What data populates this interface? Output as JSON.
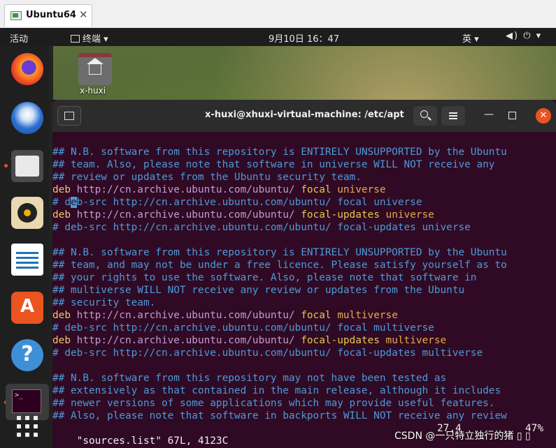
{
  "vm_tab": {
    "title": "Ubuntu64",
    "close": "✕"
  },
  "topbar": {
    "activities": "活动",
    "app_menu": "终端 ▾",
    "clock": "9月10日  16：47",
    "ime": "英 ▾",
    "system": "◀) ⏻ ▾"
  },
  "desktop": {
    "home_label": "x-huxi"
  },
  "dock": {
    "items": [
      "firefox-icon",
      "thunderbird-icon",
      "files-icon",
      "rhythmbox-icon",
      "writer-icon",
      "software-icon",
      "help-icon",
      "terminal-icon",
      "show-apps-icon"
    ],
    "software_glyph": "A",
    "help_glyph": "?",
    "terminal_prompt": ">_"
  },
  "terminal": {
    "title": "x-huxi@xhuxi-virtual-machine: /etc/apt",
    "minimize": "—",
    "close": "✕",
    "lines": [
      [
        {
          "t": "## N.B. software from this repository is ENTIRELY UNSUPPORTED by the Ubuntu",
          "c": "c"
        }
      ],
      [
        {
          "t": "## team. Also, please note that software in universe WILL NOT receive any",
          "c": "c"
        }
      ],
      [
        {
          "t": "## review or updates from the Ubuntu security team.",
          "c": "c"
        }
      ],
      [
        {
          "t": "deb",
          "c": "k"
        },
        {
          "t": " http://cn.archive.ubuntu.com/ubuntu/ ",
          "c": "u"
        },
        {
          "t": "focal",
          "c": "s"
        },
        {
          "t": " universe",
          "c": "p"
        }
      ],
      [
        {
          "t": "# d",
          "c": "c"
        },
        {
          "t": "e",
          "c": "cursor"
        },
        {
          "t": "b-src http://cn.archive.ubuntu.com/ubuntu/ focal universe",
          "c": "c"
        }
      ],
      [
        {
          "t": "deb",
          "c": "k"
        },
        {
          "t": " http://cn.archive.ubuntu.com/ubuntu/ ",
          "c": "u"
        },
        {
          "t": "focal-updates",
          "c": "s"
        },
        {
          "t": " universe",
          "c": "p"
        }
      ],
      [
        {
          "t": "# deb-src http://cn.archive.ubuntu.com/ubuntu/ focal-updates universe",
          "c": "c"
        }
      ],
      [
        {
          "t": "",
          "c": "c"
        }
      ],
      [
        {
          "t": "## N.B. software from this repository is ENTIRELY UNSUPPORTED by the Ubuntu",
          "c": "c"
        }
      ],
      [
        {
          "t": "## team, and may not be under a free licence. Please satisfy yourself as to",
          "c": "c"
        }
      ],
      [
        {
          "t": "## your rights to use the software. Also, please note that software in",
          "c": "c"
        }
      ],
      [
        {
          "t": "## multiverse WILL NOT receive any review or updates from the Ubuntu",
          "c": "c"
        }
      ],
      [
        {
          "t": "## security team.",
          "c": "c"
        }
      ],
      [
        {
          "t": "deb",
          "c": "k"
        },
        {
          "t": " http://cn.archive.ubuntu.com/ubuntu/ ",
          "c": "u"
        },
        {
          "t": "focal",
          "c": "s"
        },
        {
          "t": " multiverse",
          "c": "p"
        }
      ],
      [
        {
          "t": "# deb-src http://cn.archive.ubuntu.com/ubuntu/ focal multiverse",
          "c": "c"
        }
      ],
      [
        {
          "t": "deb",
          "c": "k"
        },
        {
          "t": " http://cn.archive.ubuntu.com/ubuntu/ ",
          "c": "u"
        },
        {
          "t": "focal-updates",
          "c": "s"
        },
        {
          "t": " multiverse",
          "c": "p"
        }
      ],
      [
        {
          "t": "# deb-src http://cn.archive.ubuntu.com/ubuntu/ focal-updates multiverse",
          "c": "c"
        }
      ],
      [
        {
          "t": "",
          "c": "c"
        }
      ],
      [
        {
          "t": "## N.B. software from this repository may not have been tested as",
          "c": "c"
        }
      ],
      [
        {
          "t": "## extensively as that contained in the main release, although it includes",
          "c": "c"
        }
      ],
      [
        {
          "t": "## newer versions of some applications which may provide useful features.",
          "c": "c"
        }
      ],
      [
        {
          "t": "## Also, please note that software in backports WILL NOT receive any review",
          "c": "c"
        }
      ]
    ],
    "status": {
      "file": "\"sources.list\" 67L, 4123C",
      "position": "27,4",
      "percent": "47%"
    }
  },
  "watermark": "CSDN @一只特立独行的猪 ▯ ▯"
}
